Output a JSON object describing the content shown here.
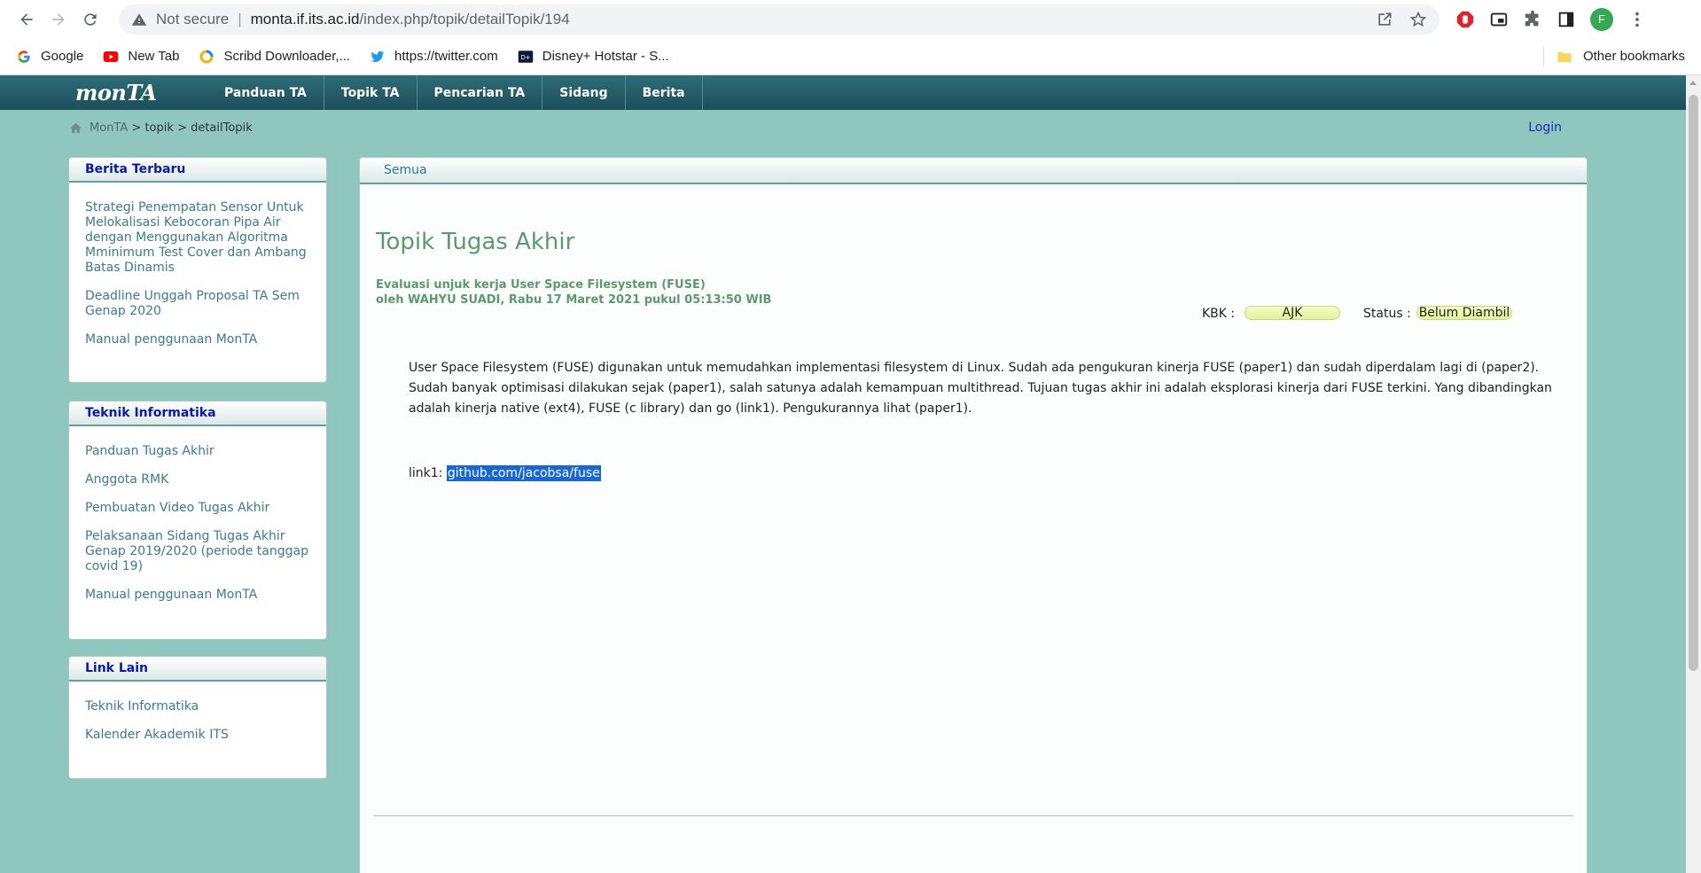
{
  "browser": {
    "security_label": "Not secure",
    "url_host": "monta.if.its.ac.id",
    "url_path": "/index.php/topik/detailTopik/194",
    "profile_initial": "F",
    "bookmarks": [
      {
        "label": "Google",
        "icon": "google-icon"
      },
      {
        "label": "New Tab",
        "icon": "youtube-icon"
      },
      {
        "label": "Scribd Downloader,...",
        "icon": "scribd-icon"
      },
      {
        "label": "https://twitter.com",
        "icon": "twitter-icon"
      },
      {
        "label": "Disney+ Hotstar - S...",
        "icon": "hotstar-icon"
      }
    ],
    "other_bookmarks": "Other bookmarks"
  },
  "site": {
    "logo": "monTA",
    "menu": [
      "Panduan TA",
      "Topik TA",
      "Pencarian TA",
      "Sidang",
      "Berita"
    ],
    "breadcrumb": {
      "home": "MonTA",
      "sep": ">",
      "level1": "topik",
      "level2": "detailTopik"
    },
    "login": "Login"
  },
  "sidebar": {
    "news": {
      "title": "Berita Terbaru",
      "items": [
        "Strategi Penempatan Sensor Untuk Melokalisasi Kebocoran Pipa Air dengan Menggunakan Algoritma Mminimum Test Cover dan Ambang Batas Dinamis",
        "Deadline Unggah Proposal TA Sem Genap 2020",
        "Manual penggunaan MonTA"
      ]
    },
    "ti": {
      "title": "Teknik Informatika",
      "items": [
        "Panduan Tugas Akhir",
        "Anggota RMK",
        "Pembuatan Video Tugas Akhir",
        "Pelaksanaan Sidang Tugas Akhir Genap 2019/2020 (periode tanggap covid 19)",
        "Manual penggunaan MonTA"
      ]
    },
    "links": {
      "title": "Link Lain",
      "items": [
        "Teknik Informatika",
        "Kalender Akademik ITS"
      ]
    }
  },
  "main": {
    "tab": "Semua",
    "heading": "Topik Tugas Akhir",
    "topic_title": "Evaluasi unjuk kerja User Space Filesystem (FUSE)",
    "byline": "oleh WAHYU SUADI, Rabu 17 Maret 2021 pukul 05:13:50 WIB",
    "kbk_label": "KBK :",
    "kbk_value": "AJK",
    "status_label": "Status :",
    "status_value": "Belum Diambil",
    "description": "User Space Filesystem (FUSE) digunakan untuk memudahkan implementasi filesystem di Linux. Sudah ada pengukuran kinerja FUSE (paper1) dan sudah diperdalam lagi di (paper2). Sudah banyak optimisasi dilakukan sejak (paper1), salah satunya adalah kemampuan multithread. Tujuan tugas akhir ini adalah eksplorasi kinerja dari FUSE terkini. Yang dibandingkan adalah kinerja native (ext4), FUSE (c library) dan go (link1). Pengukurannya lihat (paper1).",
    "link_label": "link1:",
    "link_text": "github.com/jacobsa/fuse"
  }
}
